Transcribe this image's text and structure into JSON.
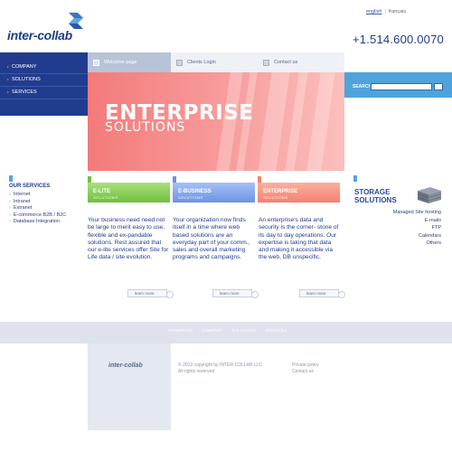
{
  "header": {
    "lang_active": "english",
    "lang_inactive": "français",
    "logo_text": "inter-collab",
    "phone": "+1.514.600.0070"
  },
  "nav": {
    "items": [
      "COMPANY",
      "SOLUTIONS",
      "SERVICES"
    ]
  },
  "tabs": [
    "Welcome page",
    "Clients Login",
    "Contact us"
  ],
  "hero": {
    "title": "ENTERPRISE",
    "subtitle": "SOLUTIONS"
  },
  "search": {
    "label": "SEARCH",
    "placeholder": ""
  },
  "services": {
    "title": "OUR SERVICES",
    "items": [
      "Internet",
      "Intranet",
      "Extranet",
      "E-commerce B2B / B2C",
      "Database Integration"
    ]
  },
  "cards": [
    {
      "title": "E-LITE",
      "subtitle": "SOLUTIONS",
      "body": "Your business need need not be large to merit easy to use, flexible and ex-pandable solutions. Rest assured that our e-lite services offer Site for Life data / site evolution.",
      "link": "learn more"
    },
    {
      "title": "E-BUSINESS",
      "subtitle": "SOLUTIONS",
      "body": "Your organization now finds itself in a time where web based solutions are an everyday part of your comm., sales and overall marketing programs and campaigns.",
      "link": "learn more"
    },
    {
      "title": "ENTERPRISE",
      "subtitle": "SOLUTIONS",
      "body": "An enterprise's data and security is the corner- stone of its day to day operations. Our expertise is taking that data and making it accessible via the web, DB unspecific.",
      "link": "learn more"
    }
  ],
  "storage": {
    "title_line1": "STORAGE",
    "title_line2": "SOLUTIONS",
    "items": [
      "Managed Site hosting",
      "E-mails",
      "FTP",
      "Calendars",
      "Others"
    ]
  },
  "footer": {
    "nav": [
      "HOMEPAGE",
      "COMPANY",
      "SOLUTIONS",
      "SERVICES"
    ],
    "logo_text": "inter-collab",
    "copyright_line1": "© 2013 copyright by INTER-COLLAB LLC",
    "copyright_line2": "All rights reserved",
    "privacy": "Private policy",
    "contact": "Contact us"
  },
  "colors": {
    "brand_blue": "#213c8e",
    "search_blue": "#4fa3dc",
    "hero_red": "#f47a7a",
    "card_green": "#6fc040",
    "card_blue": "#6e92e6",
    "card_salmon": "#f58070"
  }
}
